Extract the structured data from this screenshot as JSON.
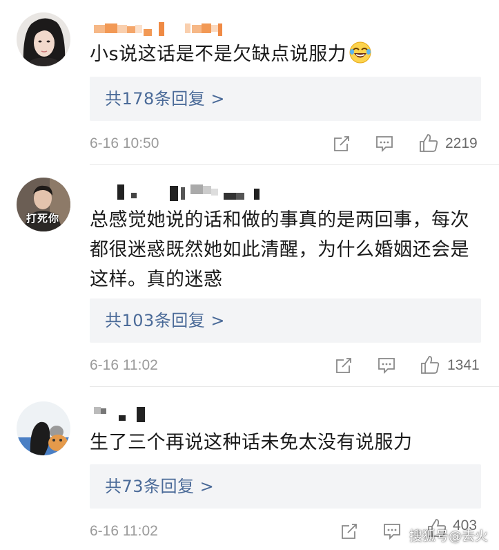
{
  "comments": [
    {
      "text": "小s说这话是不是欠缺点说服力",
      "emoji": "laughing-tears-emoji",
      "reply_label": "共178条回复 >",
      "time": "6-16 10:50",
      "like_count": "2219"
    },
    {
      "avatar_caption": "打死你",
      "text": "总感觉她说的话和做的事真的是两回事，每次都很迷惑既然她如此清醒，为什么婚姻还会是这样。真的迷惑",
      "reply_label": "共103条回复 >",
      "time": "6-16 11:02",
      "like_count": "1341"
    },
    {
      "text": "生了三个再说这种话未免太没有说服力",
      "reply_label": "共73条回复 >",
      "time": "6-16 11:02",
      "like_count": "403"
    }
  ],
  "watermark": "搜狐号@去火",
  "colors": {
    "link_blue": "#4a6a98",
    "reply_bg": "#f3f4f6",
    "meta_gray": "#9a9a9a",
    "username_blur_orange": "#f4a66a"
  }
}
